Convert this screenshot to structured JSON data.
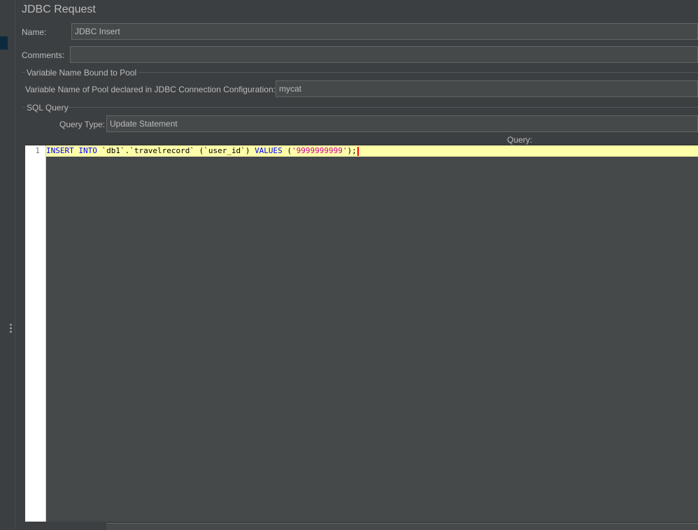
{
  "panel": {
    "title": "JDBC Request"
  },
  "name": {
    "label": "Name:",
    "value": "JDBC Insert"
  },
  "comments": {
    "label": "Comments:",
    "value": ""
  },
  "pool_group": {
    "title": "Variable Name Bound to Pool",
    "label": "Variable Name of Pool declared in JDBC Connection Configuration:",
    "value": "mycat"
  },
  "sql_group": {
    "title": "SQL Query",
    "query_type_label": "Query Type:",
    "query_type_value": "Update Statement",
    "query_label": "Query:"
  },
  "editor": {
    "line_number": "1",
    "tokens": {
      "kw1": "INSERT",
      "kw2": "INTO",
      "table": " `db1`.`travelrecord` ",
      "paren_open": "(",
      "column": "`user_id`",
      "paren_close": ")",
      "kw3": "VALUES",
      "paren_open2": "(",
      "value": "'9999999999'",
      "end": ");"
    }
  },
  "colors": {
    "background": "#3c3f41",
    "field": "#45494a",
    "current_line": "#ffffaa",
    "keyword": "#0000ff",
    "string": "#cc0099"
  }
}
